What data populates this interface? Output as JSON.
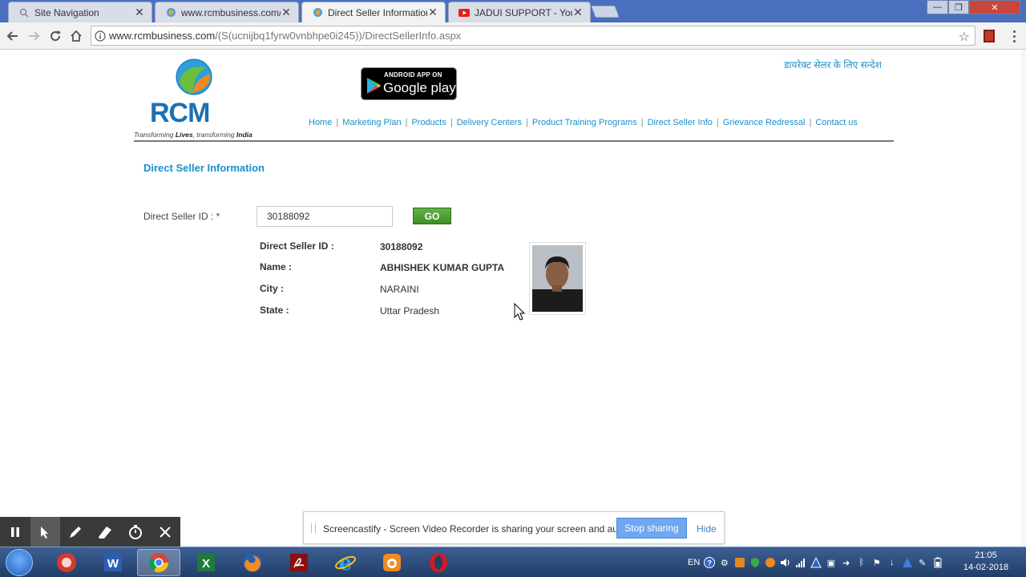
{
  "browser": {
    "tabs": [
      {
        "title": "Site Navigation",
        "active": false
      },
      {
        "title": "www.rcmbusiness.com/(S",
        "active": false
      },
      {
        "title": "Direct Seller Information",
        "active": true
      },
      {
        "title": "JADUI SUPPORT - YouTu",
        "active": false
      }
    ],
    "url_host": "www.rcmbusiness.com",
    "url_path": "/(S(ucnijbq1fyrw0vnbhpe0i245))/DirectSellerInfo.aspx"
  },
  "site": {
    "logo_text": "RCM",
    "tagline_prefix": "Transforming",
    "tagline_lives": "Lives",
    "tagline_mid": ", transforming",
    "tagline_india": "India",
    "app_badge_small": "ANDROID APP ON",
    "app_badge_big": "Google play",
    "hindi_link": "डायरेक्ट सेलर के लिए सन्देश",
    "nav": [
      "Home",
      "Marketing Plan",
      "Products",
      "Delivery Centers",
      "Product Training Programs",
      "Direct Seller Info",
      "Grievance Redressal",
      "Contact us"
    ]
  },
  "main": {
    "heading": "Direct Seller Information",
    "form_label": "Direct Seller ID : *",
    "id_value": "30188092",
    "go_label": "GO",
    "details": {
      "id_label": "Direct Seller ID :",
      "id_value": "30188092",
      "name_label": "Name :",
      "name_value": "ABHISHEK KUMAR GUPTA",
      "city_label": "City :",
      "city_value": "NARAINI",
      "state_label": "State :",
      "state_value": "Uttar Pradesh"
    }
  },
  "screencastify": {
    "message": "Screencastify - Screen Video Recorder is sharing your screen and audio.",
    "stop_label": "Stop sharing",
    "hide_label": "Hide"
  },
  "taskbar": {
    "lang": "EN",
    "time": "21:05",
    "date": "14-02-2018"
  },
  "colors": {
    "link_blue": "#1a8fc9",
    "go_green": "#4a9d33"
  }
}
